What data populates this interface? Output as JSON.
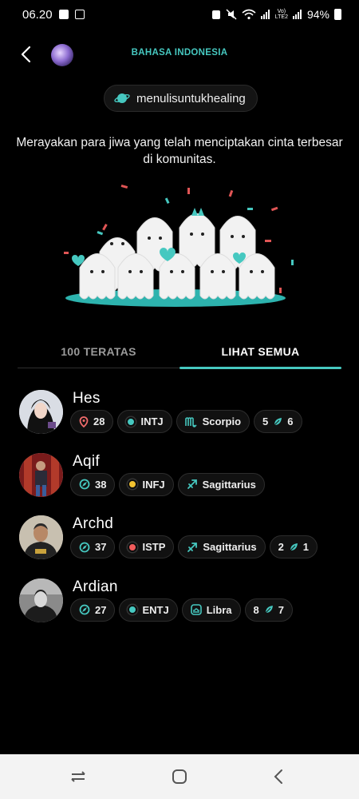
{
  "status_bar": {
    "time": "06.20",
    "network": "Vo)\nLTE2",
    "battery": "94%"
  },
  "header": {
    "title": "BAHASA INDONESIA"
  },
  "community": {
    "tag": "menulisuntukhealing"
  },
  "tagline": "Merayakan para jiwa yang telah menciptakan cinta terbesar di komunitas.",
  "tabs": [
    {
      "label": "100 TERATAS"
    },
    {
      "label": "LIHAT SEMUA"
    }
  ],
  "colors": {
    "accent": "#46c8c0",
    "intj": "#46c8c0",
    "infj": "#f2c230",
    "istp": "#f05b5b",
    "entj": "#46c8c0"
  },
  "users": [
    {
      "name": "Hes",
      "level": "28",
      "level_icon": "pin-icon",
      "mbti": "INTJ",
      "mbti_color": "#46c8c0",
      "zodiac": "Scorpio",
      "zodiac_icon": "scorpio-icon",
      "stat_a": "5",
      "stat_b": "6"
    },
    {
      "name": "Aqif",
      "level": "38",
      "level_icon": "compass-icon",
      "mbti": "INFJ",
      "mbti_color": "#f2c230",
      "zodiac": "Sagittarius",
      "zodiac_icon": "sagittarius-icon"
    },
    {
      "name": "Archd",
      "level": "37",
      "level_icon": "compass-icon",
      "mbti": "ISTP",
      "mbti_color": "#f05b5b",
      "zodiac": "Sagittarius",
      "zodiac_icon": "sagittarius-icon",
      "stat_a": "2",
      "stat_b": "1"
    },
    {
      "name": "Ardian",
      "level": "27",
      "level_icon": "compass-icon",
      "mbti": "ENTJ",
      "mbti_color": "#46c8c0",
      "zodiac": "Libra",
      "zodiac_icon": "libra-icon",
      "stat_a": "8",
      "stat_b": "7"
    }
  ]
}
